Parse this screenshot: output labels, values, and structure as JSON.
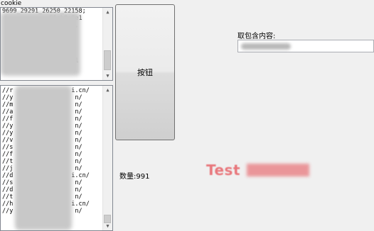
{
  "cookie_group": {
    "label": "cookie",
    "lines": [
      "9699_29291_26250_22158;",
      "             51cb8c9e1",
      "               51159,",
      "",
      "              scn83",
      "",
      "",
      "             1cb8c9e1",
      "           8"
    ]
  },
  "url_list": {
    "lines": [
      "//r                i.cn/",
      "//y                 n/",
      "//m                 n/",
      "//a                 n/",
      "//f                 n/",
      "//y                 n/",
      "//y                 n/",
      "//v                 n/",
      "//s                 n/",
      "//f                 n/",
      "//t                 n/",
      "//j                 n/",
      "//d                i.cn/",
      "//s                 n/",
      "//d                 n/",
      "//t                 n/",
      "//h                i.cn/",
      "//y                 n/"
    ]
  },
  "button": {
    "label": "按钮"
  },
  "filter": {
    "label": "取包含内容:",
    "value": ""
  },
  "count": {
    "label": "数量:991"
  },
  "watermark": {
    "text": "Test"
  }
}
